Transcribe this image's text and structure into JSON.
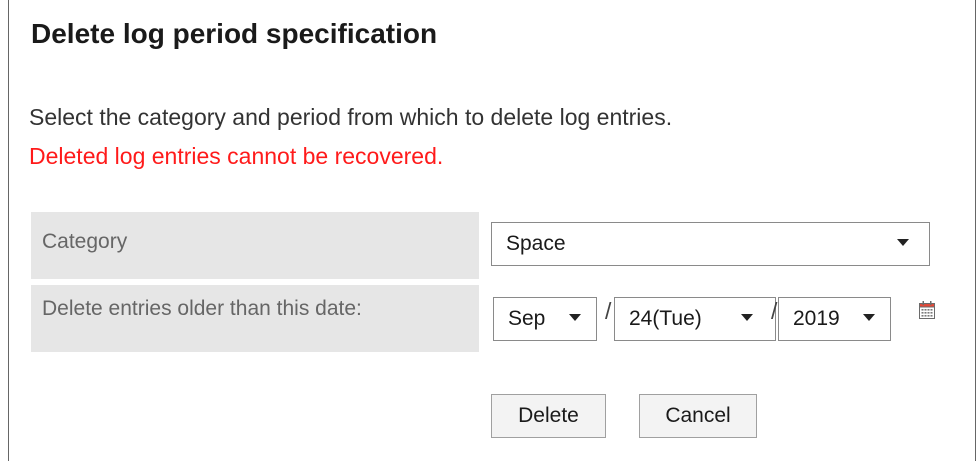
{
  "dialog": {
    "title": "Delete log period specification",
    "description": "Select the category and period from which to delete log entries.",
    "warning": "Deleted log entries cannot be recovered.",
    "warning_color": "#ff1a1a"
  },
  "form": {
    "category_label": "Category",
    "category_value": "Space",
    "date_label": "Delete entries older than this date:",
    "month_value": "Sep",
    "day_value": "24(Tue)",
    "year_value": "2019",
    "separator": "/",
    "calendar_icon": "calendar-icon"
  },
  "buttons": {
    "delete_label": "Delete",
    "cancel_label": "Cancel"
  }
}
